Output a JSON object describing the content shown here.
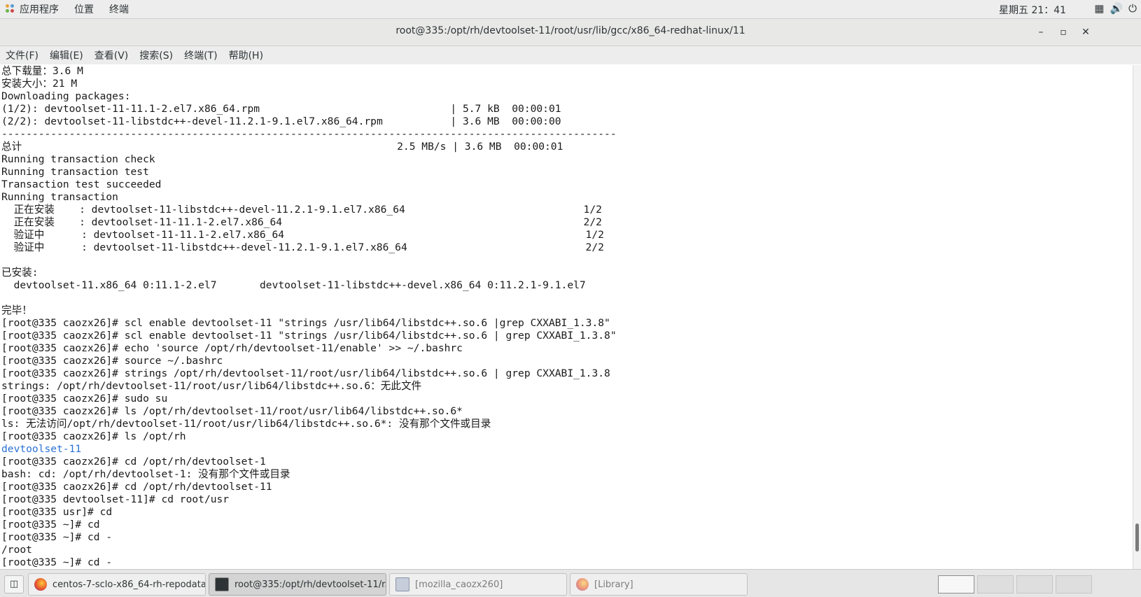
{
  "topbar": {
    "applications": "应用程序",
    "places": "位置",
    "terminal": "终端",
    "clock": "星期五 21：41",
    "icons": [
      "network-icon",
      "volume-icon",
      "power-icon"
    ]
  },
  "window": {
    "title": "root@335:/opt/rh/devtoolset-11/root/usr/lib/gcc/x86_64-redhat-linux/11",
    "minimize": "–",
    "maximize": "▫",
    "close": "✕"
  },
  "menu": [
    "文件(F)",
    "编辑(E)",
    "查看(V)",
    "搜索(S)",
    "终端(T)",
    "帮助(H)"
  ],
  "terminal": {
    "lines_before": [
      "总下载量：3.6 M",
      "安装大小：21 M",
      "Downloading packages:",
      "(1/2): devtoolset-11-11.1-2.el7.x86_64.rpm                               | 5.7 kB  00:00:01",
      "(2/2): devtoolset-11-libstdc++-devel-11.2.1-9.1.el7.x86_64.rpm           | 3.6 MB  00:00:00",
      "----------------------------------------------------------------------------------------------------",
      "总计                                                             2.5 MB/s | 3.6 MB  00:00:01",
      "Running transaction check",
      "Running transaction test",
      "Transaction test succeeded",
      "Running transaction",
      "  正在安装    : devtoolset-11-libstdc++-devel-11.2.1-9.1.el7.x86_64                             1/2",
      "  正在安装    : devtoolset-11-11.1-2.el7.x86_64                                                 2/2",
      "  验证中      : devtoolset-11-11.1-2.el7.x86_64                                                 1/2",
      "  验证中      : devtoolset-11-libstdc++-devel-11.2.1-9.1.el7.x86_64                             2/2",
      "",
      "已安装:",
      "  devtoolset-11.x86_64 0:11.1-2.el7       devtoolset-11-libstdc++-devel.x86_64 0:11.2.1-9.1.el7",
      "",
      "完毕！",
      "[root@335 caozx26]# scl enable devtoolset-11 \"strings /usr/lib64/libstdc++.so.6 |grep CXXABI_1.3.8\"",
      "[root@335 caozx26]# scl enable devtoolset-11 \"strings /usr/lib64/libstdc++.so.6 | grep CXXABI_1.3.8\"",
      "[root@335 caozx26]# echo 'source /opt/rh/devtoolset-11/enable' >> ~/.bashrc",
      "[root@335 caozx26]# source ~/.bashrc",
      "[root@335 caozx26]# strings /opt/rh/devtoolset-11/root/usr/lib64/libstdc++.so.6 | grep CXXABI_1.3.8",
      "strings: /opt/rh/devtoolset-11/root/usr/lib64/libstdc++.so.6：无此文件",
      "[root@335 caozx26]# sudo su",
      "[root@335 caozx26]# ls /opt/rh/devtoolset-11/root/usr/lib64/libstdc++.so.6*",
      "ls: 无法访问/opt/rh/devtoolset-11/root/usr/lib64/libstdc++.so.6*: 没有那个文件或目录",
      "[root@335 caozx26]# ls /opt/rh"
    ],
    "dir_listing": "devtoolset-11",
    "lines_after": [
      "[root@335 caozx26]# cd /opt/rh/devtoolset-1",
      "bash: cd: /opt/rh/devtoolset-1: 没有那个文件或目录",
      "[root@335 caozx26]# cd /opt/rh/devtoolset-11",
      "[root@335 devtoolset-11]# cd root/usr",
      "[root@335 usr]# cd",
      "[root@335 ~]# cd",
      "[root@335 ~]# cd -",
      "/root",
      "[root@335 ~]# cd -"
    ]
  },
  "taskbar": {
    "tasks": [
      {
        "label": "centos-7-sclo-x86_64-rh-repodata...",
        "icon": "firefox-icon"
      },
      {
        "label": "root@335:/opt/rh/devtoolset-11/r...",
        "icon": "terminal-icon"
      },
      {
        "label": "[mozilla_caozx260]",
        "icon": "file-manager-icon"
      },
      {
        "label": "[Library]",
        "icon": "firefox-icon"
      }
    ],
    "colors": {
      "firefox": "#e8552c",
      "terminal": "#2e3436"
    }
  }
}
